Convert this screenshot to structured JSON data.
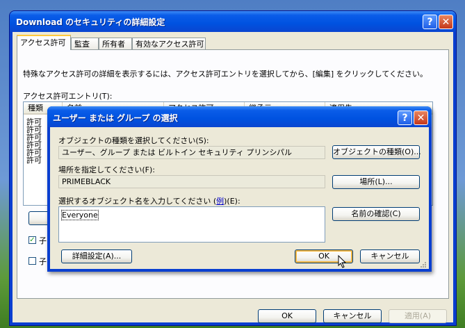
{
  "window": {
    "title": "Download のセキュリティの詳細設定",
    "help": "?",
    "close": "✕"
  },
  "tabs": [
    "アクセス許可",
    "監査",
    "所有者",
    "有効なアクセス許可"
  ],
  "main": {
    "instruction": "特殊なアクセス許可の詳細を表示するには、アクセス許可エントリを選択してから、[編集] をクリックしてください。",
    "entries_label": "アクセス許可エントリ(T):",
    "columns": [
      "種類",
      "名前",
      "アクセス許可",
      "継承元",
      "適用先"
    ],
    "row_prefixes": [
      "許可",
      "許可",
      "許可",
      "許可",
      "許可",
      "許可"
    ],
    "check1_partial": "子",
    "check2_partial": "子"
  },
  "footer": {
    "ok": "OK",
    "cancel": "キャンセル",
    "apply": "適用(A)"
  },
  "dialog": {
    "title": "ユーザー または グループ の選択",
    "help": "?",
    "close": "✕",
    "type_label": "オブジェクトの種類を選択してください(S):",
    "type_value": "ユーザー、グループ または ビルトイン セキュリティ プリンシパル",
    "type_button": "オブジェクトの種類(O)...",
    "location_label": "場所を指定してください(F):",
    "location_value": "PRIMEBLACK",
    "location_button": "場所(L)...",
    "names_label_pre": "選択するオブジェクト名を入力してください (",
    "names_label_link": "例",
    "names_label_post": ")(E):",
    "names_value": "Everyone",
    "check_button": "名前の確認(C)",
    "advanced_button": "詳細設定(A)...",
    "ok": "OK",
    "cancel": "キャンセル"
  }
}
